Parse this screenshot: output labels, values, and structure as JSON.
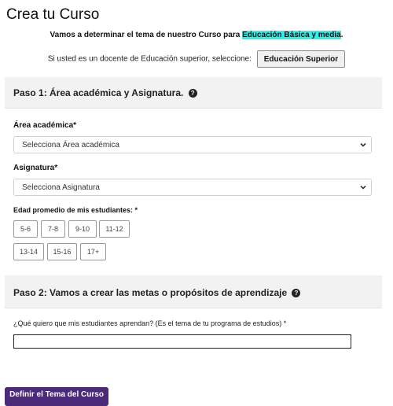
{
  "page": {
    "title": "Crea tu Curso",
    "intro_text": "Vamos a determinar el tema de nuestro Curso para ",
    "intro_highlight": "Educación Básica y media",
    "intro_end": ".",
    "superior_text": "Si usted es un docente de Educación superior, seleccione:",
    "superior_button": "Educación Superior"
  },
  "step1": {
    "title": "Paso 1: Área académica y Asignatura.",
    "help_icon": "question-circle-icon",
    "area": {
      "label": "Área académica*",
      "selected": "Selecciona Área académica"
    },
    "subject": {
      "label": "Asignatura*",
      "selected": "Selecciona Asignatura"
    },
    "age": {
      "label": "Edad promedio de mis estudiantes: *",
      "options": [
        "5-6",
        "7-8",
        "9-10",
        "11-12",
        "13-14",
        "15-16",
        "17+"
      ]
    }
  },
  "step2": {
    "title": "Paso 2: Vamos a crear las metas o propósitos de aprendizaje",
    "help_icon": "question-circle-icon",
    "question_label": "¿Qué quiero que mis estudiantes aprendan? (Es el tema de tu programa de estudios) *",
    "question_value": ""
  },
  "submit": {
    "label": "Definir el Tema del Curso"
  }
}
